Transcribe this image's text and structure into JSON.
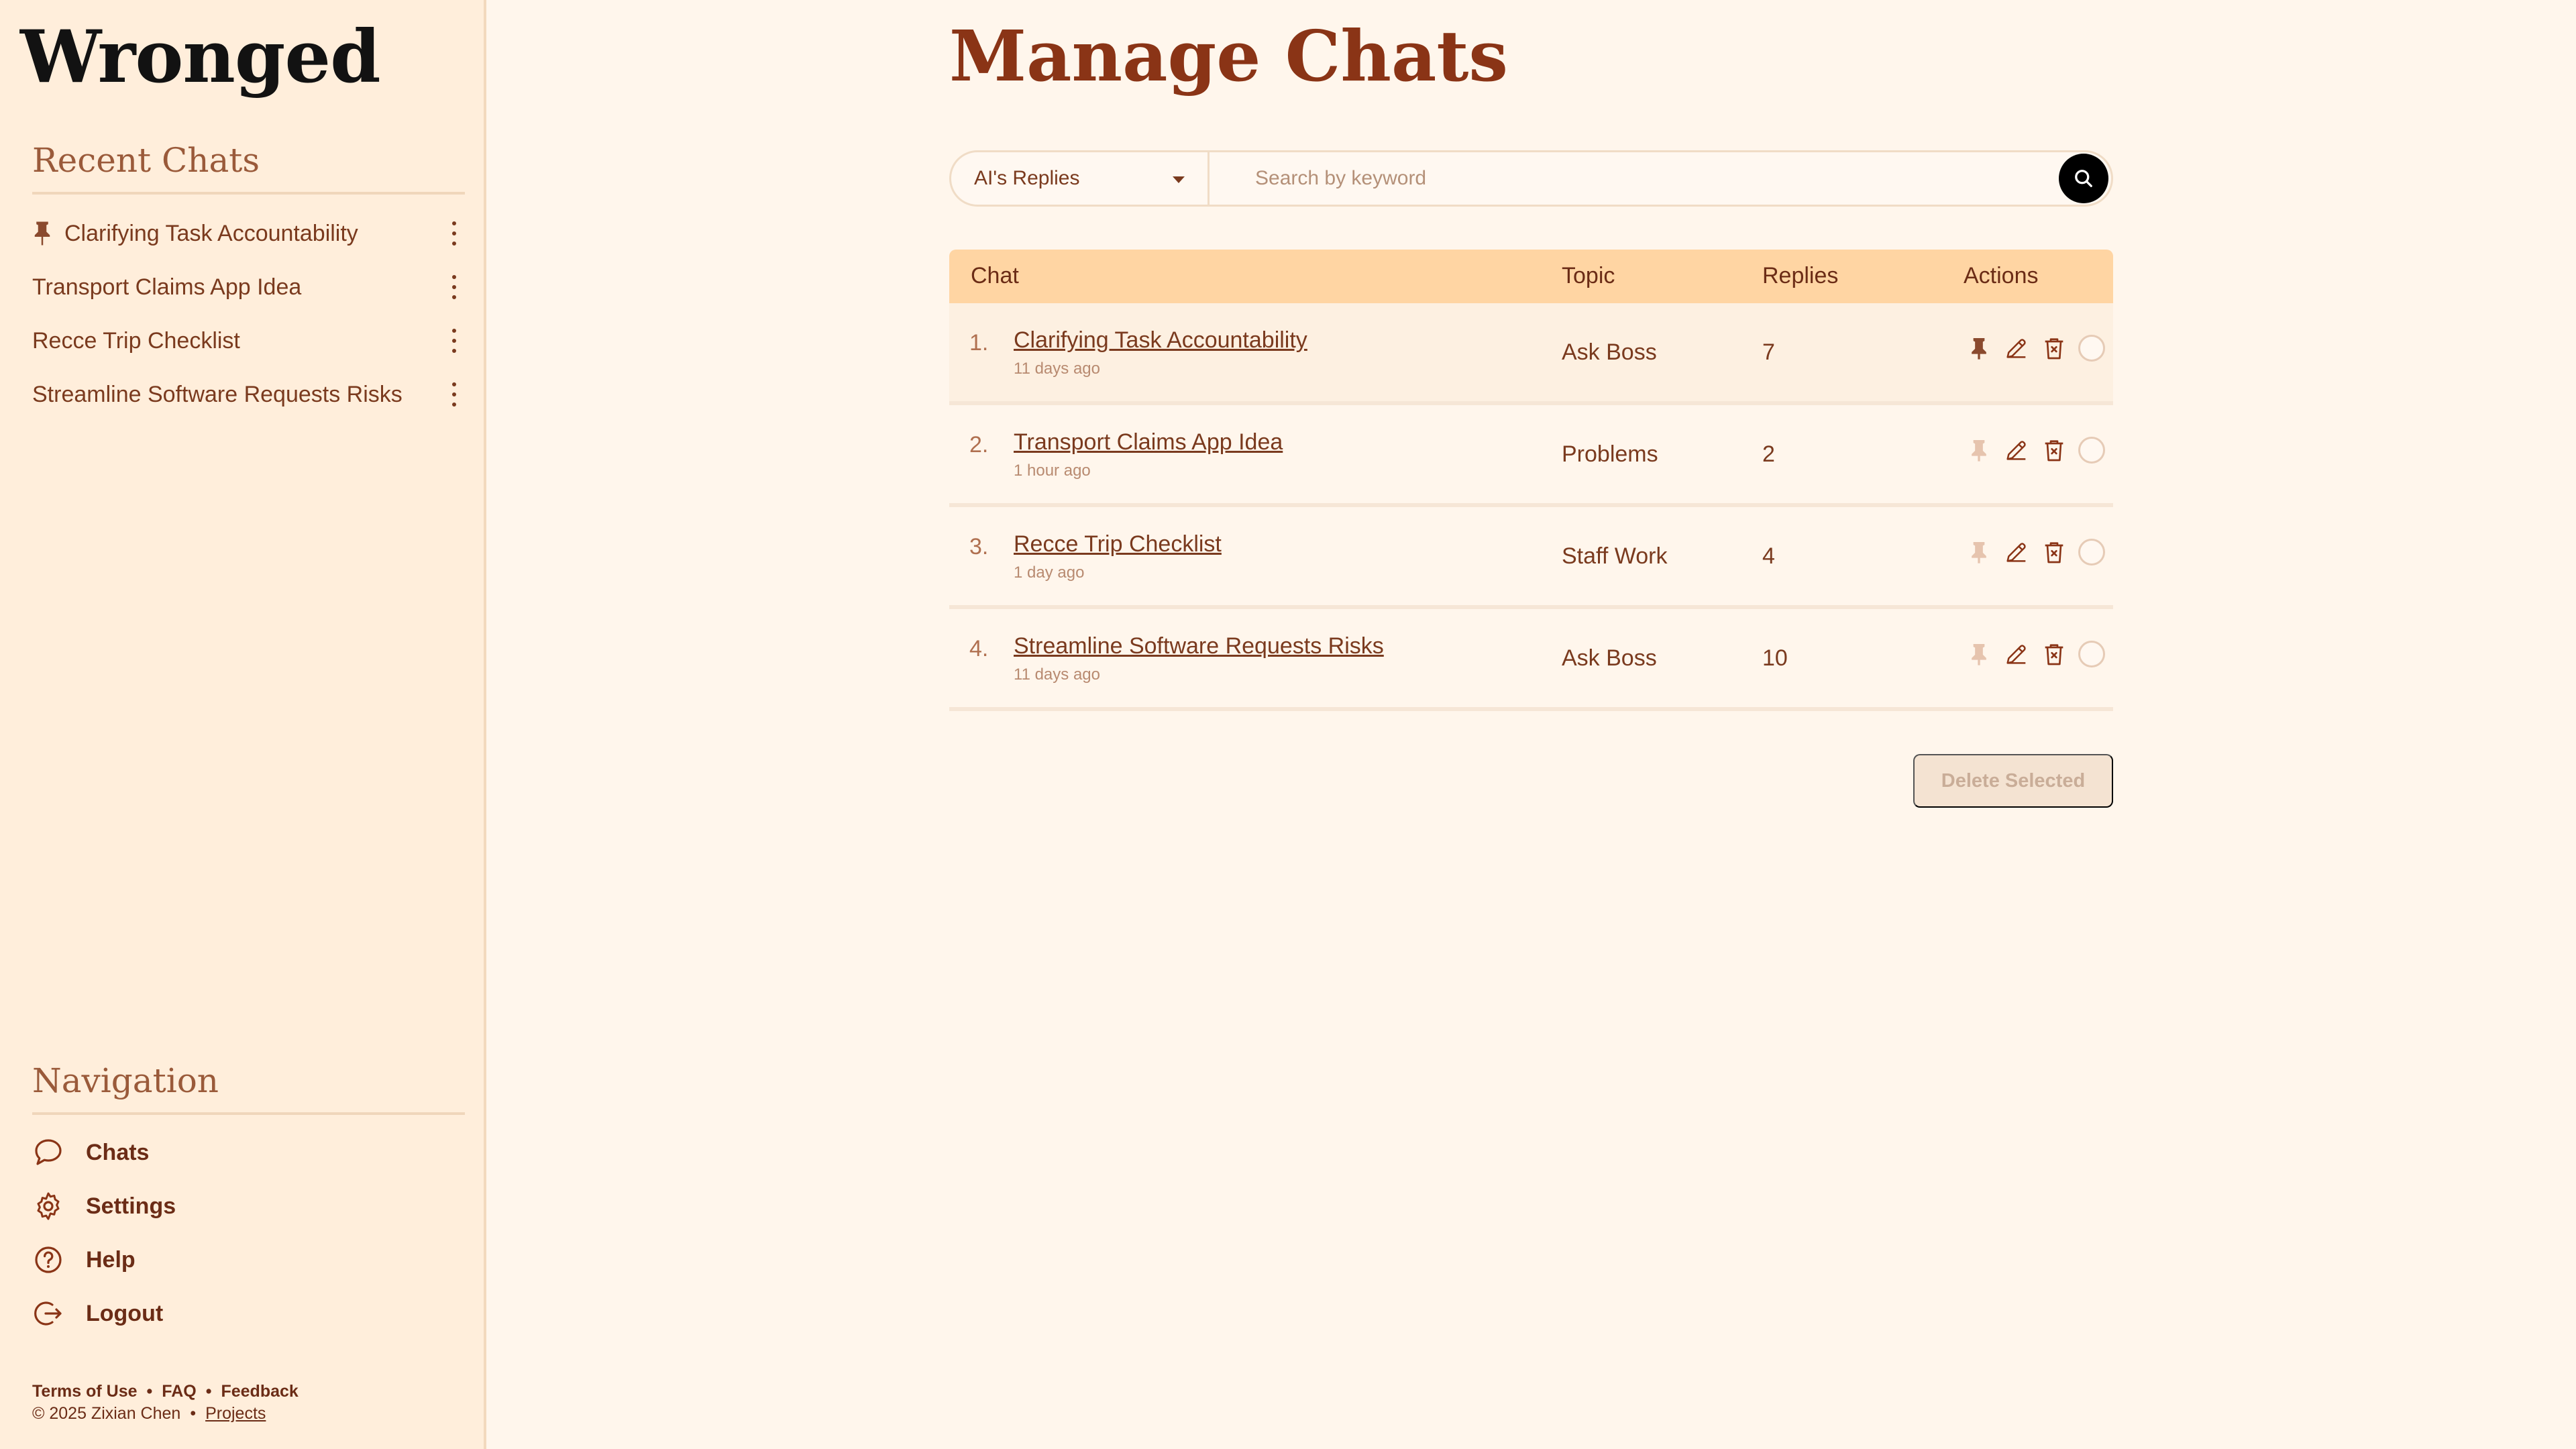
{
  "app": {
    "logo": "Wronged"
  },
  "sidebar": {
    "recent_title": "Recent Chats",
    "recent": [
      {
        "label": "Clarifying Task Accountability",
        "pinned": true
      },
      {
        "label": "Transport Claims App Idea",
        "pinned": false
      },
      {
        "label": "Recce Trip Checklist",
        "pinned": false
      },
      {
        "label": "Streamline Software Requests Risks",
        "pinned": false
      }
    ],
    "nav_title": "Navigation",
    "nav": [
      {
        "label": "Chats",
        "icon": "chat-bubble-icon"
      },
      {
        "label": "Settings",
        "icon": "gear-icon"
      },
      {
        "label": "Help",
        "icon": "question-icon"
      },
      {
        "label": "Logout",
        "icon": "logout-icon"
      }
    ],
    "footer": {
      "terms": "Terms of Use",
      "faq": "FAQ",
      "feedback": "Feedback",
      "copyright": "© 2025 Zixian Chen",
      "projects": "Projects"
    }
  },
  "main": {
    "title": "Manage Chats",
    "filter": {
      "selected": "AI's Replies"
    },
    "search": {
      "placeholder": "Search by keyword",
      "value": ""
    },
    "table": {
      "headers": {
        "chat": "Chat",
        "topic": "Topic",
        "replies": "Replies",
        "actions": "Actions"
      },
      "rows": [
        {
          "num": "1.",
          "title": "Clarifying Task Accountability",
          "ago": "11 days ago",
          "topic": "Ask Boss",
          "replies": "7",
          "pinned": true
        },
        {
          "num": "2.",
          "title": "Transport Claims App Idea",
          "ago": "1 hour ago",
          "topic": "Problems",
          "replies": "2",
          "pinned": false
        },
        {
          "num": "3.",
          "title": "Recce Trip Checklist",
          "ago": "1 day ago",
          "topic": "Staff Work",
          "replies": "4",
          "pinned": false
        },
        {
          "num": "4.",
          "title": "Streamline Software Requests Risks",
          "ago": "11 days ago",
          "topic": "Ask Boss",
          "replies": "10",
          "pinned": false
        }
      ]
    },
    "delete_selected": "Delete Selected"
  },
  "colors": {
    "accent": "#8a3416",
    "sidebar_bg": "#ffeedb",
    "page_bg": "#fff6ec",
    "header_bg": "#ffd5a3",
    "pin_active": "#8a4a2e",
    "pin_inactive": "#e6c4ae"
  }
}
